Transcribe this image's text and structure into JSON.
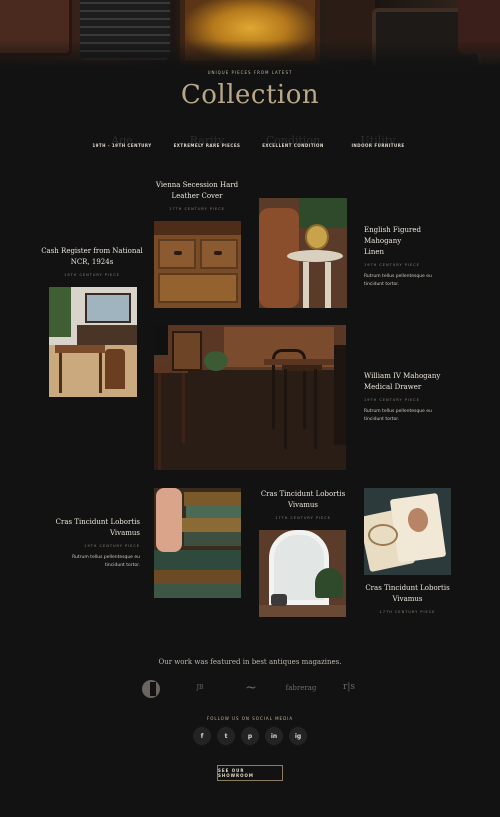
{
  "hero": {
    "kicker": "UNIQUE PIECES FROM LATEST",
    "title": "Collection"
  },
  "features": [
    {
      "ghost": "Age",
      "label": "19TH - 19TH CENTURY"
    },
    {
      "ghost": "Rarity",
      "label": "EXTREMELY RARE PIECES"
    },
    {
      "ghost": "Condition",
      "label": "EXCELLENT CONDITION"
    },
    {
      "ghost": "Utility",
      "label": "INDOOR FURNITURE"
    }
  ],
  "products": {
    "vienna": {
      "title_l1": "Vienna Secession Hard",
      "title_l2": "Leather Cover",
      "meta": "17TH CENTURY PIECE"
    },
    "cash": {
      "title_l1": "Cash Register from National",
      "title_l2": "NCR, 1924s",
      "meta": "19TH CENTURY PIECE"
    },
    "english": {
      "title_l1": "English Figured Mahogany",
      "title_l2": "Linen",
      "meta": "19TH CENTURY PIECE",
      "desc_l1": "Rutrum tellus pellentesque eu",
      "desc_l2": "tincidunt tortor."
    },
    "william": {
      "title_l1": "William IV Mahogany",
      "title_l2": "Medical Drawer",
      "meta": "19TH CENTURY PIECE",
      "desc_l1": "Rutrum tellus pellentesque eu",
      "desc_l2": "tincidunt tortor."
    },
    "cras_left": {
      "title_l1": "Cras Tincidunt Lobortis",
      "title_l2": "Vivamus",
      "meta": "19TH CENTURY PIECE",
      "desc_l1": "Rutrum tellus pellentesque eu",
      "desc_l2": "tincidunt tortor."
    },
    "cras_mid": {
      "title_l1": "Cras Tincidunt Lobortis",
      "title_l2": "Vivamus",
      "meta": "17TH CENTURY PIECE"
    },
    "cras_right": {
      "title_l1": "Cras Tincidunt Lobortis",
      "title_l2": "Vivamus",
      "meta": "17TH CENTURY PIECE"
    }
  },
  "magazines": {
    "heading": "Our work was featured in best antiques magazines.",
    "logos": [
      "C",
      "JB",
      "~",
      "fabrerag",
      "r|s"
    ]
  },
  "social": {
    "heading": "FOLLOW US ON SOCIAL MEDIA",
    "icons": [
      "f",
      "t",
      "p",
      "in",
      "ig"
    ]
  },
  "cta": {
    "label": "SEE OUR SHOWROOM"
  },
  "colors": {
    "background": "#121212",
    "accent": "#b9a888",
    "button_border": "#8d7d60"
  }
}
